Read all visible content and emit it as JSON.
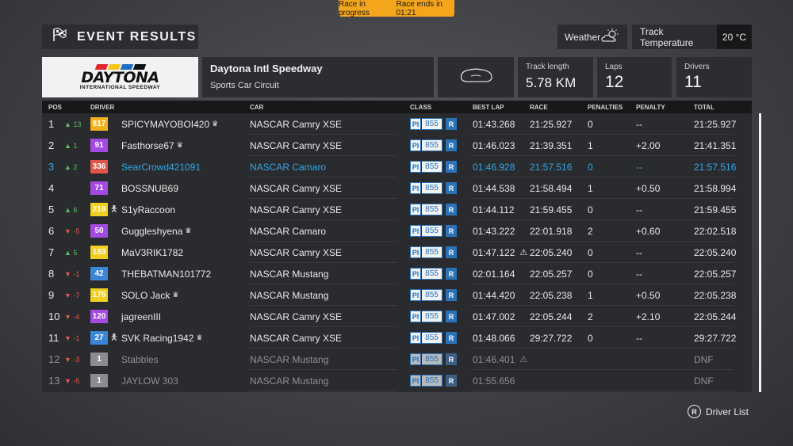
{
  "status": {
    "left": "Race in progress",
    "right": "Race ends in 01:21",
    "color": "#f3a51c"
  },
  "header": {
    "title": "EVENT RESULTS",
    "flag_icon": "checkered-flag-icon"
  },
  "weather": {
    "label": "Weather",
    "icon": "partly-cloudy-icon"
  },
  "temperature": {
    "label": "Track Temperature",
    "value": "20 °C"
  },
  "logo": {
    "big": "DAYTONA",
    "small": "INTERNATIONAL SPEEDWAY"
  },
  "track": {
    "name": "Daytona Intl Speedway",
    "layout": "Sports Car Circuit",
    "map_icon": "track-map-icon"
  },
  "stats": {
    "length": {
      "label": "Track length",
      "value": "5.78 KM"
    },
    "laps": {
      "label": "Laps",
      "value": "12"
    },
    "drivers": {
      "label": "Drivers",
      "value": "11"
    }
  },
  "columns": {
    "pos": "POS",
    "driver": "DRIVER",
    "car": "CAR",
    "class": "CLASS",
    "best": "BEST LAP",
    "race": "RACE",
    "penalties": "PENALTIES",
    "penalty": "PENALTY",
    "total": "TOTAL"
  },
  "rows": [
    {
      "pos": "1",
      "chg": "▲ 13",
      "dir": "up",
      "badge": "817",
      "badge_color": "#f0b21f",
      "person": "",
      "driver": "SPICYMAYOBOI420",
      "crown": "♛",
      "car": "NASCAR Camry XSE",
      "pi": "PI",
      "cls": "855",
      "r": "R",
      "best": "01:43.268",
      "warn": "",
      "race": "21:25.927",
      "pens": "0",
      "pen": "--",
      "total": "21:25.927"
    },
    {
      "pos": "2",
      "chg": "▲ 1",
      "dir": "up",
      "badge": "91",
      "badge_color": "#a34ae0",
      "person": "",
      "driver": "Fasthorse67",
      "crown": "♛",
      "car": "NASCAR Camry XSE",
      "pi": "PI",
      "cls": "855",
      "r": "R",
      "best": "01:46.023",
      "warn": "",
      "race": "21:39.351",
      "pens": "1",
      "pen": "+2.00",
      "total": "21:41.351"
    },
    {
      "pos": "3",
      "chg": "▲ 2",
      "dir": "up",
      "badge": "336",
      "badge_color": "#e0574a",
      "person": "",
      "driver": "SearCrowd421091",
      "crown": "",
      "car": "NASCAR Camaro",
      "pi": "PI",
      "cls": "855",
      "r": "R",
      "best": "01:46.928",
      "warn": "",
      "race": "21:57.516",
      "pens": "0",
      "pen": "--",
      "total": "21:57.516"
    },
    {
      "pos": "4",
      "chg": "",
      "dir": "",
      "badge": "71",
      "badge_color": "#a34ae0",
      "person": "",
      "driver": "BOSSNUB69",
      "crown": "",
      "car": "NASCAR Camry XSE",
      "pi": "PI",
      "cls": "855",
      "r": "R",
      "best": "01:44.538",
      "warn": "",
      "race": "21:58.494",
      "pens": "1",
      "pen": "+0.50",
      "total": "21:58.994"
    },
    {
      "pos": "5",
      "chg": "▲ 6",
      "dir": "up",
      "badge": "219",
      "badge_color": "#f0cf1f",
      "person": "🯅",
      "driver": "S1yRaccoon",
      "crown": "",
      "car": "NASCAR Camry XSE",
      "pi": "PI",
      "cls": "855",
      "r": "R",
      "best": "01:44.112",
      "warn": "",
      "race": "21:59.455",
      "pens": "0",
      "pen": "--",
      "total": "21:59.455"
    },
    {
      "pos": "6",
      "chg": "▼ -5",
      "dir": "down",
      "badge": "50",
      "badge_color": "#a34ae0",
      "person": "",
      "driver": "Guggleshyena",
      "crown": "♛",
      "car": "NASCAR Camaro",
      "pi": "PI",
      "cls": "855",
      "r": "R",
      "best": "01:43.222",
      "warn": "",
      "race": "22:01.918",
      "pens": "2",
      "pen": "+0.60",
      "total": "22:02.518"
    },
    {
      "pos": "7",
      "chg": "▲ 5",
      "dir": "up",
      "badge": "183",
      "badge_color": "#f0cf1f",
      "person": "",
      "driver": "MaV3RIK1782",
      "crown": "",
      "car": "NASCAR Camry XSE",
      "pi": "PI",
      "cls": "855",
      "r": "R",
      "best": "01:47.122",
      "warn": "⚠",
      "race": "22:05.240",
      "pens": "0",
      "pen": "--",
      "total": "22:05.240"
    },
    {
      "pos": "8",
      "chg": "▼ -1",
      "dir": "down",
      "badge": "42",
      "badge_color": "#3b86d6",
      "person": "",
      "driver": "THEBATMAN101772",
      "crown": "",
      "car": "NASCAR Mustang",
      "pi": "PI",
      "cls": "855",
      "r": "R",
      "best": "02:01.164",
      "warn": "",
      "race": "22:05.257",
      "pens": "0",
      "pen": "--",
      "total": "22:05.257"
    },
    {
      "pos": "9",
      "chg": "▼ -7",
      "dir": "down",
      "badge": "175",
      "badge_color": "#f0cf1f",
      "person": "",
      "driver": "SOLO Jack",
      "crown": "♛",
      "car": "NASCAR Mustang",
      "pi": "PI",
      "cls": "855",
      "r": "R",
      "best": "01:44.420",
      "warn": "",
      "race": "22:05.238",
      "pens": "1",
      "pen": "+0.50",
      "total": "22:05.238"
    },
    {
      "pos": "10",
      "chg": "▼ -4",
      "dir": "down",
      "badge": "120",
      "badge_color": "#a34ae0",
      "person": "",
      "driver": "jagreenIII",
      "crown": "",
      "car": "NASCAR Camry XSE",
      "pi": "PI",
      "cls": "855",
      "r": "R",
      "best": "01:47.002",
      "warn": "",
      "race": "22:05.244",
      "pens": "2",
      "pen": "+2.10",
      "total": "22:05.244"
    },
    {
      "pos": "11",
      "chg": "▼ -1",
      "dir": "down",
      "badge": "27",
      "badge_color": "#3b86d6",
      "person": "🯅",
      "driver": "SVK Racing1942",
      "crown": "♛",
      "car": "NASCAR Camry XSE",
      "pi": "PI",
      "cls": "855",
      "r": "R",
      "best": "01:48.066",
      "warn": "",
      "race": "29:27.722",
      "pens": "0",
      "pen": "--",
      "total": "29:27.722"
    },
    {
      "pos": "12",
      "chg": "▼ -3",
      "dir": "down",
      "badge": "1",
      "badge_color": "#8b8c8f",
      "person": "",
      "driver": "Stabbles",
      "crown": "",
      "car": "NASCAR Mustang",
      "pi": "PI",
      "cls": "855",
      "r": "R",
      "best": "01:46.401",
      "warn": "⚠",
      "race": "",
      "pens": "",
      "pen": "",
      "total": "DNF"
    },
    {
      "pos": "13",
      "chg": "▼ -5",
      "dir": "down",
      "badge": "1",
      "badge_color": "#8b8c8f",
      "person": "",
      "driver": "JAYLOW 303",
      "crown": "",
      "car": "NASCAR Mustang",
      "pi": "PI",
      "cls": "855",
      "r": "R",
      "best": "01:55.656",
      "warn": "",
      "race": "",
      "pens": "",
      "pen": "",
      "total": "DNF"
    }
  ],
  "highlight_row": 2,
  "dim_from_row": 11,
  "footer": {
    "button": "R",
    "label": "Driver List"
  }
}
